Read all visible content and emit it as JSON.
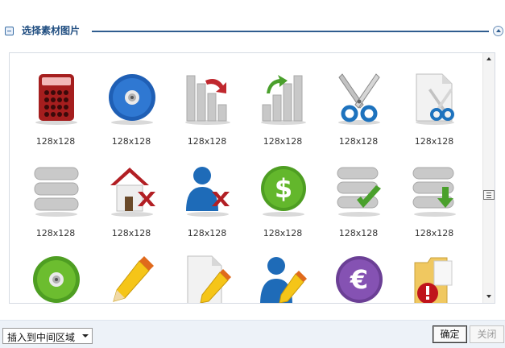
{
  "header": {
    "title": "选择素材图片"
  },
  "gallery": {
    "items": [
      {
        "icon": "calculator-icon",
        "label": "128x128"
      },
      {
        "icon": "cd-icon",
        "label": "128x128"
      },
      {
        "icon": "chart-down-icon",
        "label": "128x128"
      },
      {
        "icon": "chart-up-icon",
        "label": "128x128"
      },
      {
        "icon": "scissors-icon",
        "label": "128x128"
      },
      {
        "icon": "cut-document-icon",
        "label": "128x128"
      },
      {
        "icon": "database-icon",
        "label": "128x128"
      },
      {
        "icon": "home-delete-icon",
        "label": "128x128"
      },
      {
        "icon": "user-delete-icon",
        "label": "128x128"
      },
      {
        "icon": "dollar-coin-icon",
        "label": "128x128"
      },
      {
        "icon": "database-check-icon",
        "label": "128x128"
      },
      {
        "icon": "database-download-icon",
        "label": "128x128"
      },
      {
        "icon": "green-cd-icon",
        "label": ""
      },
      {
        "icon": "pencil-icon",
        "label": ""
      },
      {
        "icon": "document-edit-icon",
        "label": ""
      },
      {
        "icon": "user-edit-icon",
        "label": ""
      },
      {
        "icon": "euro-coin-icon",
        "label": ""
      },
      {
        "icon": "folder-alert-icon",
        "label": ""
      }
    ]
  },
  "footer": {
    "insert_option": "插入到中间区域",
    "ok_label": "确定",
    "close_label": "关闭"
  },
  "colors": {
    "accent": "#2f5d8f",
    "title": "#1f4d80",
    "footer_bg": "#edf2f8"
  }
}
